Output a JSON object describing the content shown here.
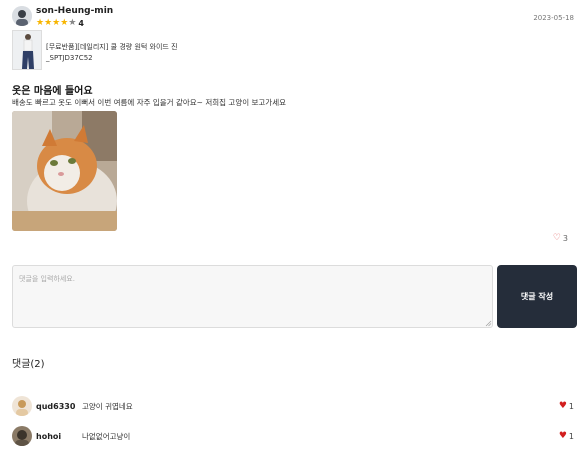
{
  "review": {
    "username": "son-Heung-min",
    "rating": "4",
    "rating_value": 4,
    "max_rating": 5,
    "date": "2023-05-18",
    "product_name": "[무료반품][데일리지] 쿨 경량 원턱 와이드 진 _SPTJD37C52",
    "title": "옷은 마음에 들어요",
    "body": "배송도 빠르고 옷도 이뻐서 이번 여름에 자주 입을거 같아요~ 저희집 고양이 보고가세요",
    "like_count": "3"
  },
  "comment_form": {
    "placeholder": "댓글을 입력하세요.",
    "value": "",
    "submit_label": "댓글 작성"
  },
  "comments": {
    "heading": "댓글(2)",
    "items": [
      {
        "user": "qud6330",
        "text": "고양이 귀엽네요",
        "likes": "1"
      },
      {
        "user": "hohoi",
        "text": "나없없어고냥이",
        "likes": "1"
      }
    ]
  },
  "colors": {
    "star": "#f7b500",
    "submit_bg": "#252d3a",
    "like_heart": "#d21f1f"
  }
}
